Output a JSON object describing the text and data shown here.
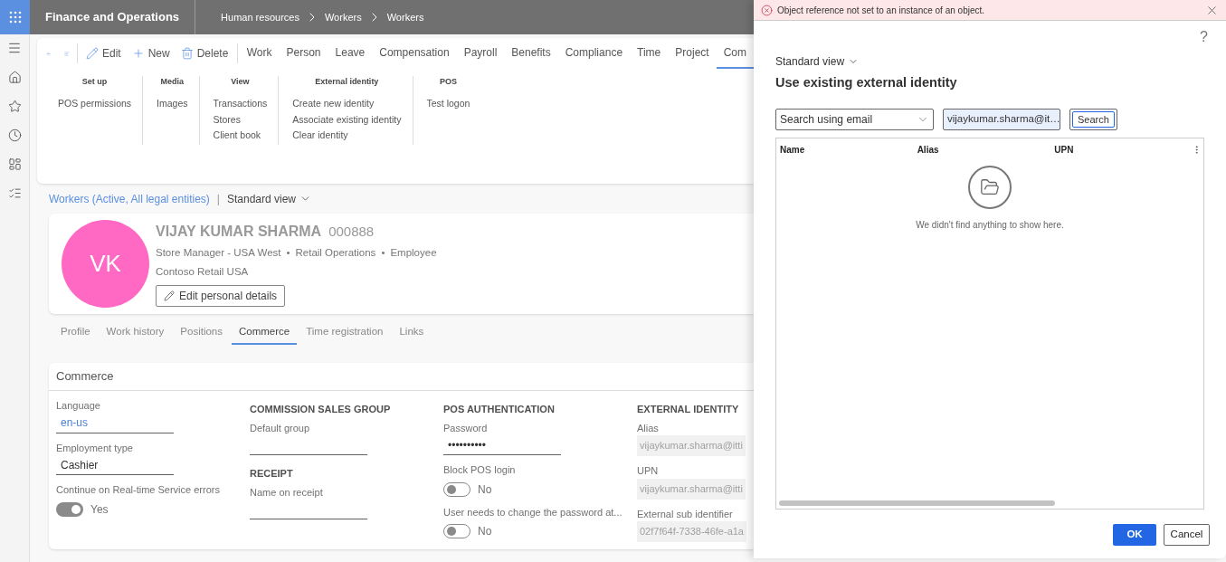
{
  "app": {
    "title": "Finance and Operations",
    "breadcrumb": [
      "Human resources",
      "Workers",
      "Workers"
    ]
  },
  "action_pane": {
    "buttons": [
      {
        "label": "Edit",
        "kind": "edit"
      },
      {
        "label": "New",
        "kind": "new"
      },
      {
        "label": "Delete",
        "kind": "delete"
      }
    ],
    "tabs": [
      {
        "label": "Work",
        "selected": false
      },
      {
        "label": "Person",
        "selected": false
      },
      {
        "label": "Leave",
        "selected": false
      },
      {
        "label": "Compensation",
        "selected": false
      },
      {
        "label": "Payroll",
        "selected": false
      },
      {
        "label": "Benefits",
        "selected": false
      },
      {
        "label": "Compliance",
        "selected": false
      },
      {
        "label": "Time",
        "selected": false
      },
      {
        "label": "Project",
        "selected": false
      },
      {
        "label": "Com",
        "selected": true
      }
    ],
    "groups": [
      {
        "title": "Set up",
        "items": [
          "POS permissions"
        ]
      },
      {
        "title": "Media",
        "items": [
          "Images"
        ]
      },
      {
        "title": "View",
        "items": [
          "Transactions",
          "Stores",
          "Client book"
        ]
      },
      {
        "title": "External identity",
        "items": [
          "Create new identity",
          "Associate existing identity",
          "Clear identity"
        ]
      },
      {
        "title": "POS",
        "items": [
          "Test logon"
        ]
      }
    ]
  },
  "list_header": {
    "link": "Workers (Active, All legal entities)",
    "separator": "|",
    "view": "Standard view"
  },
  "worker": {
    "initials": "VK",
    "name": "VIJAY KUMAR SHARMA",
    "id": "000888",
    "details": [
      "Store Manager - USA West",
      "Retail Operations",
      "Employee"
    ],
    "bullet": "•",
    "company": "Contoso Retail USA",
    "edit_button": "Edit personal details"
  },
  "detail_tabs": [
    {
      "label": "Profile",
      "selected": false
    },
    {
      "label": "Work history",
      "selected": false
    },
    {
      "label": "Positions",
      "selected": false
    },
    {
      "label": "Commerce",
      "selected": true
    },
    {
      "label": "Time registration",
      "selected": false
    },
    {
      "label": "Links",
      "selected": false
    }
  ],
  "commerce": {
    "title": "Commerce",
    "columns": [
      [
        {
          "kind": "lookup",
          "label": "Language",
          "value": "en-us"
        },
        {
          "kind": "field",
          "label": "Employment type",
          "value": "Cashier"
        },
        {
          "kind": "toggle",
          "label": "Continue on Real-time Service errors",
          "on": true,
          "value": "Yes"
        }
      ],
      [
        {
          "kind": "heading",
          "text": "COMMISSION SALES GROUP"
        },
        {
          "kind": "field",
          "label": "Default group"
        },
        {
          "kind": "heading",
          "text": "RECEIPT"
        },
        {
          "kind": "field",
          "label": "Name on receipt"
        }
      ],
      [
        {
          "kind": "heading",
          "text": "POS AUTHENTICATION"
        },
        {
          "kind": "field",
          "label": "Password",
          "value": "••••••••••"
        },
        {
          "kind": "toggle",
          "label": "Block POS login",
          "on": false,
          "value": "No"
        },
        {
          "kind": "toggle",
          "label": "User needs to change the password at...",
          "on": false,
          "value": "No"
        }
      ],
      [
        {
          "kind": "heading",
          "text": "EXTERNAL IDENTITY"
        },
        {
          "kind": "readonly",
          "label": "Alias",
          "value": "vijaykumar.sharma@itti"
        },
        {
          "kind": "readonly",
          "label": "UPN",
          "value": "vijaykumar.sharma@itti"
        },
        {
          "kind": "readonly",
          "label": "External sub identifier",
          "value": "02f7f64f-7338-46fe-a1a"
        }
      ]
    ]
  },
  "dialog": {
    "error": "Object reference not set to an instance of an object.",
    "help": "?",
    "view": "Standard view",
    "title": "Use existing external identity",
    "search_type": "Search using email",
    "search_value": "vijaykumar.sharma@it…",
    "search_button": "Search",
    "grid": {
      "columns": [
        "Name",
        "Alias",
        "UPN"
      ],
      "empty_message": "We didn't find anything to show here."
    },
    "buttons": [
      {
        "label": "OK",
        "kind": "primary"
      },
      {
        "label": "Cancel",
        "kind": "secondary"
      }
    ]
  }
}
